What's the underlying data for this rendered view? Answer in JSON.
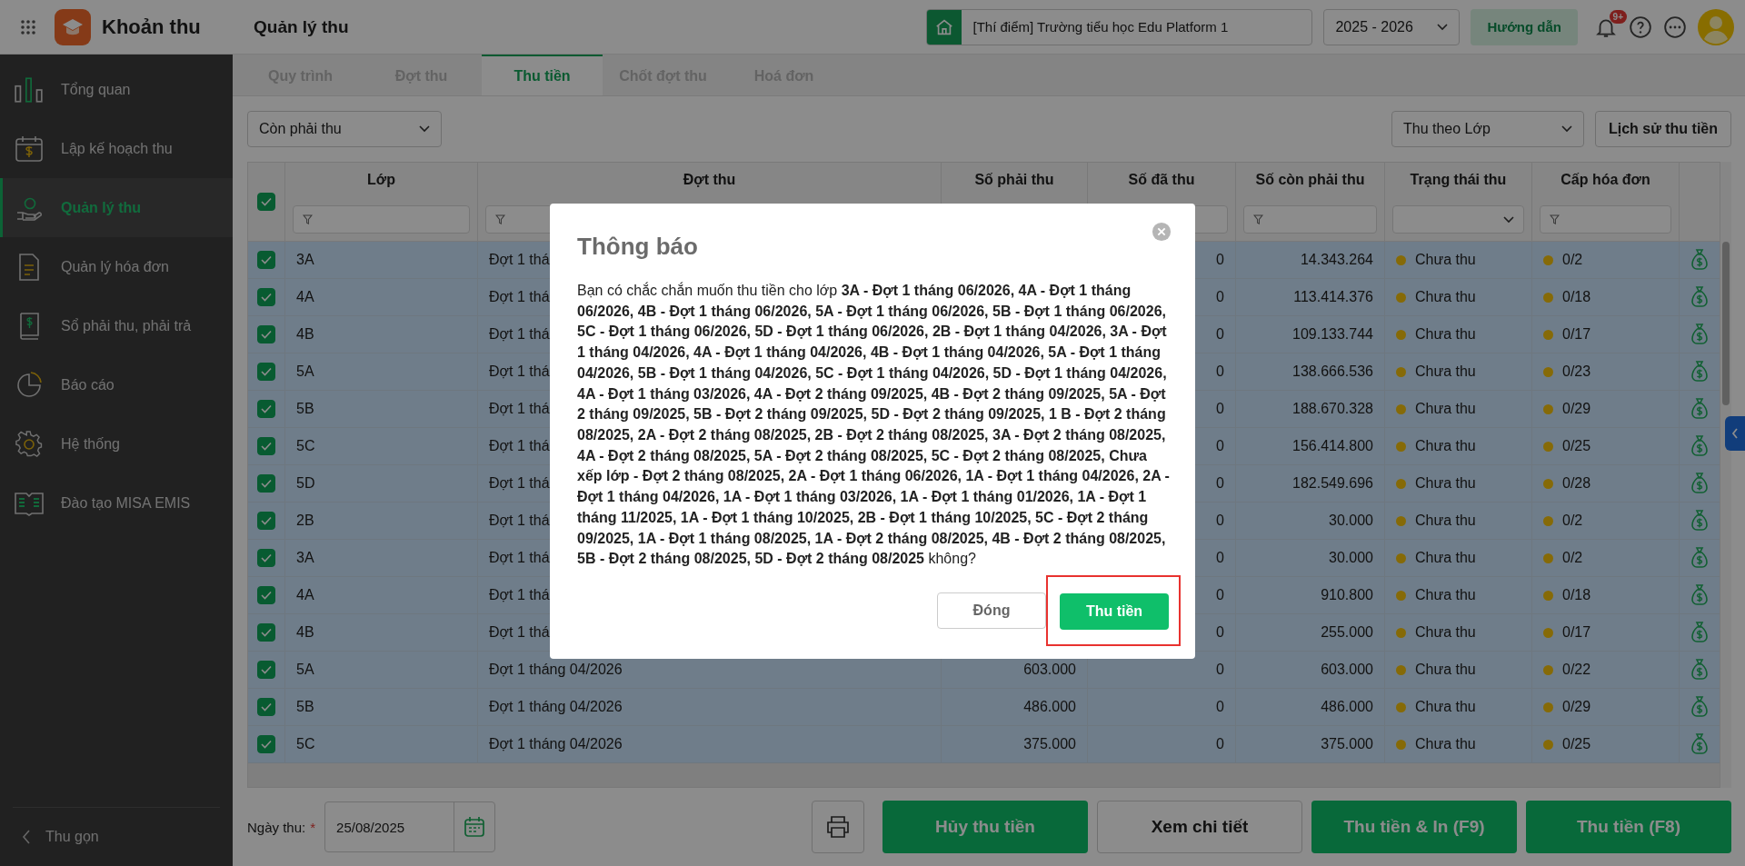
{
  "header": {
    "app_title": "Khoản thu",
    "page_title": "Quản lý thu",
    "school": "[Thí điểm] Trường tiểu học Edu Platform 1",
    "year": "2025 - 2026",
    "guide_button": "Hướng dẫn",
    "notification_badge": "9+"
  },
  "sidebar": {
    "items": [
      {
        "label": "Tổng quan",
        "selected": false
      },
      {
        "label": "Lập kế hoạch thu",
        "selected": false
      },
      {
        "label": "Quản lý thu",
        "selected": true
      },
      {
        "label": "Quản lý hóa đơn",
        "selected": false
      },
      {
        "label": "Sổ phải thu, phải trả",
        "selected": false
      },
      {
        "label": "Báo cáo",
        "selected": false
      },
      {
        "label": "Hệ thống",
        "selected": false
      },
      {
        "label": "Đào tạo MISA EMIS",
        "selected": false
      }
    ],
    "collapse": "Thu gọn"
  },
  "tabs": [
    {
      "label": "Quy trình",
      "selected": false
    },
    {
      "label": "Đợt thu",
      "selected": false
    },
    {
      "label": "Thu tiền",
      "selected": true
    },
    {
      "label": "Chốt đợt thu",
      "selected": false
    },
    {
      "label": "Hoá đơn",
      "selected": false
    }
  ],
  "toolbar": {
    "filter": "Còn phải thu",
    "group_by": "Thu theo Lớp",
    "history_button": "Lịch sử thu tiền"
  },
  "table": {
    "all_checked": true,
    "columns": [
      "Lớp",
      "Đợt thu",
      "Số phải thu",
      "Số đã thu",
      "Số còn phải thu",
      "Trạng thái thu",
      "Cấp hóa đơn"
    ],
    "rows": [
      {
        "checked": true,
        "class": "3A",
        "batch": "Đợt 1 thá",
        "paid": "0",
        "remaining": "14.343.264",
        "status": "Chưa thu",
        "invoices": "0/2"
      },
      {
        "checked": true,
        "class": "4A",
        "batch": "Đợt 1 thá",
        "paid": "0",
        "remaining": "113.414.376",
        "status": "Chưa thu",
        "invoices": "0/18"
      },
      {
        "checked": true,
        "class": "4B",
        "batch": "Đợt 1 thá",
        "paid": "0",
        "remaining": "109.133.744",
        "status": "Chưa thu",
        "invoices": "0/17"
      },
      {
        "checked": true,
        "class": "5A",
        "batch": "Đợt 1 thá",
        "paid": "0",
        "remaining": "138.666.536",
        "status": "Chưa thu",
        "invoices": "0/23"
      },
      {
        "checked": true,
        "class": "5B",
        "batch": "Đợt 1 thá",
        "paid": "0",
        "remaining": "188.670.328",
        "status": "Chưa thu",
        "invoices": "0/29"
      },
      {
        "checked": true,
        "class": "5C",
        "batch": "Đợt 1 thá",
        "paid": "0",
        "remaining": "156.414.800",
        "status": "Chưa thu",
        "invoices": "0/25"
      },
      {
        "checked": true,
        "class": "5D",
        "batch": "Đợt 1 thá",
        "paid": "0",
        "remaining": "182.549.696",
        "status": "Chưa thu",
        "invoices": "0/28"
      },
      {
        "checked": true,
        "class": "2B",
        "batch": "Đợt 1 thá",
        "paid": "0",
        "remaining": "30.000",
        "status": "Chưa thu",
        "invoices": "0/2"
      },
      {
        "checked": true,
        "class": "3A",
        "batch": "Đợt 1 thá",
        "paid": "0",
        "remaining": "30.000",
        "status": "Chưa thu",
        "invoices": "0/2"
      },
      {
        "checked": true,
        "class": "4A",
        "batch": "Đợt 1 thá",
        "paid": "0",
        "remaining": "910.800",
        "status": "Chưa thu",
        "invoices": "0/18"
      },
      {
        "checked": true,
        "class": "4B",
        "batch": "Đợt 1 thá",
        "paid": "0",
        "remaining": "255.000",
        "status": "Chưa thu",
        "invoices": "0/17"
      },
      {
        "checked": true,
        "class": "5A",
        "batch": "Đợt 1 tháng 04/2026",
        "due": "603.000",
        "paid": "0",
        "remaining": "603.000",
        "status": "Chưa thu",
        "invoices": "0/22"
      },
      {
        "checked": true,
        "class": "5B",
        "batch": "Đợt 1 tháng 04/2026",
        "due": "486.000",
        "paid": "0",
        "remaining": "486.000",
        "status": "Chưa thu",
        "invoices": "0/29"
      },
      {
        "checked": true,
        "class": "5C",
        "batch": "Đợt 1 tháng 04/2026",
        "due": "375.000",
        "paid": "0",
        "remaining": "375.000",
        "status": "Chưa thu",
        "invoices": "0/25"
      }
    ]
  },
  "footer": {
    "date_label": "Ngày thu:",
    "required_mark": "*",
    "date": "25/08/2025",
    "buttons": [
      {
        "label": "Hủy thu tiền",
        "kind": "primary"
      },
      {
        "label": "Xem chi tiết",
        "kind": "secondary"
      },
      {
        "label": "Thu tiền & In (F9)",
        "kind": "primary"
      },
      {
        "label": "Thu tiền (F8)",
        "kind": "primary"
      }
    ]
  },
  "modal": {
    "title": "Thông báo",
    "message": "Bạn có chắc chắn muốn thu tiền cho lớp **3A - Đợt 1 tháng 06/2026, 4A - Đợt 1 tháng 06/2026, 4B - Đợt 1 tháng 06/2026, 5A - Đợt 1 tháng 06/2026, 5B - Đợt 1 tháng 06/2026, 5C - Đợt 1 tháng 06/2026, 5D - Đợt 1 tháng 06/2026, 2B - Đợt 1 tháng 04/2026, 3A - Đợt 1 tháng 04/2026, 4A - Đợt 1 tháng 04/2026, 4B - Đợt 1 tháng 04/2026, 5A - Đợt 1 tháng 04/2026, 5B - Đợt 1 tháng 04/2026, 5C - Đợt 1 tháng 04/2026, 5D - Đợt 1 tháng 04/2026, 4A - Đợt 1 tháng 03/2026, 4A - Đợt 2 tháng 09/2025, 4B - Đợt 2 tháng 09/2025, 5A - Đợt 2 tháng 09/2025, 5B - Đợt 2 tháng 09/2025, 5D - Đợt 2 tháng 09/2025, 1 B - Đợt 2 tháng 08/2025, 2A - Đợt 2 tháng 08/2025, 2B - Đợt 2 tháng 08/2025, 3A - Đợt 2 tháng 08/2025, 4A - Đợt 2 tháng 08/2025, 5A - Đợt 2 tháng 08/2025, 5C - Đợt 2 tháng 08/2025, Chưa xếp lớp - Đợt 2 tháng 08/2025, 2A - Đợt 1 tháng 06/2026, 1A - Đợt 1 tháng 04/2026, 2A - Đợt 1 tháng 04/2026, 1A - Đợt 1 tháng 03/2026, 1A - Đợt 1 tháng 01/2026, 1A - Đợt 1 tháng 11/2025, 1A - Đợt 1 tháng 10/2025, 2B - Đợt 1 tháng 10/2025, 5C - Đợt 2 tháng 09/2025, 1A - Đợt 1 tháng 08/2025, 1A - Đợt 2 tháng 08/2025, 4B - Đợt 2 tháng 08/2025, 5B - Đợt 2 tháng 08/2025, 5D - Đợt 2 tháng 08/2025** không?",
    "cancel_button": "Đóng",
    "confirm_button": "Thu tiền",
    "confirm_highlighted": true
  }
}
